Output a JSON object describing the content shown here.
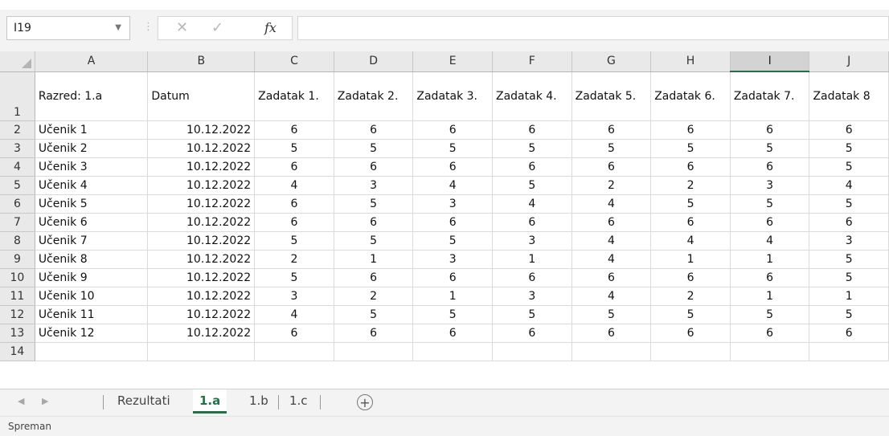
{
  "formula_bar": {
    "name_box": "I19",
    "formula": ""
  },
  "sheet": {
    "columns": [
      "A",
      "B",
      "C",
      "D",
      "E",
      "F",
      "G",
      "H",
      "I",
      "J"
    ],
    "selected_column": "I",
    "header_row": [
      "Razred: 1.a",
      "Datum",
      "Zadatak 1.",
      "Zadatak 2.",
      "Zadatak 3.",
      "Zadatak 4.",
      "Zadatak 5.",
      "Zadatak 6.",
      "Zadatak 7.",
      "Zadatak 8"
    ],
    "rows": [
      [
        "Učenik 1",
        "10.12.2022",
        "6",
        "6",
        "6",
        "6",
        "6",
        "6",
        "6",
        "6"
      ],
      [
        "Učenik 2",
        "10.12.2022",
        "5",
        "5",
        "5",
        "5",
        "5",
        "5",
        "5",
        "5"
      ],
      [
        "Učenik 3",
        "10.12.2022",
        "6",
        "6",
        "6",
        "6",
        "6",
        "6",
        "6",
        "5"
      ],
      [
        "Učenik 4",
        "10.12.2022",
        "4",
        "3",
        "4",
        "5",
        "2",
        "2",
        "3",
        "4"
      ],
      [
        "Učenik 5",
        "10.12.2022",
        "6",
        "5",
        "3",
        "4",
        "4",
        "5",
        "5",
        "5"
      ],
      [
        "Učenik 6",
        "10.12.2022",
        "6",
        "6",
        "6",
        "6",
        "6",
        "6",
        "6",
        "6"
      ],
      [
        "Učenik 7",
        "10.12.2022",
        "5",
        "5",
        "5",
        "3",
        "4",
        "4",
        "4",
        "3"
      ],
      [
        "Učenik 8",
        "10.12.2022",
        "2",
        "1",
        "3",
        "1",
        "4",
        "1",
        "1",
        "5"
      ],
      [
        "Učenik 9",
        "10.12.2022",
        "5",
        "6",
        "6",
        "6",
        "6",
        "6",
        "6",
        "5"
      ],
      [
        "Učenik 10",
        "10.12.2022",
        "3",
        "2",
        "1",
        "3",
        "4",
        "2",
        "1",
        "1"
      ],
      [
        "Učenik 11",
        "10.12.2022",
        "4",
        "5",
        "5",
        "5",
        "5",
        "5",
        "5",
        "5"
      ],
      [
        "Učenik 12",
        "10.12.2022",
        "6",
        "6",
        "6",
        "6",
        "6",
        "6",
        "6",
        "6"
      ]
    ]
  },
  "tabs": [
    {
      "label": "Rezultati",
      "active": false
    },
    {
      "label": "1.a",
      "active": true
    },
    {
      "label": "1.b",
      "active": false
    },
    {
      "label": "1.c",
      "active": false
    }
  ],
  "status": {
    "text": "Spreman"
  },
  "icons": {
    "cancel": "cancel-icon",
    "enter": "enter-icon",
    "function": "function-icon",
    "add_sheet": "plus-circle-icon",
    "nav_prev": "chevron-left-icon",
    "nav_next": "chevron-right-icon"
  },
  "colors": {
    "accent": "#217346"
  }
}
